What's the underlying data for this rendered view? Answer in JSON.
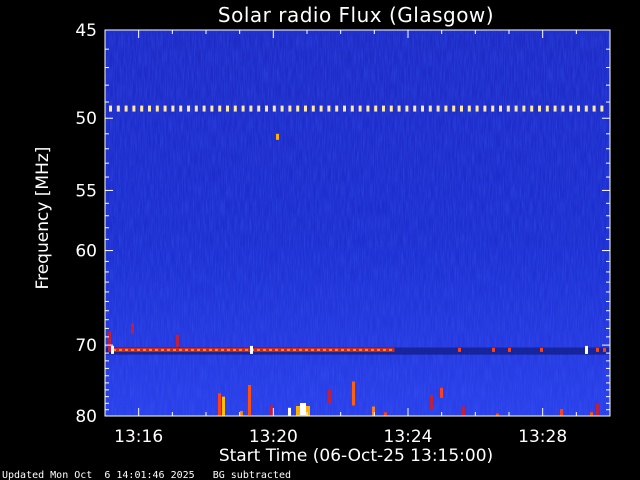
{
  "title": "Solar radio Flux (Glasgow)",
  "footer": "Updated Mon Oct  6 14:01:46 2025   BG subtracted",
  "chart_data": {
    "type": "heatmap",
    "title": "Solar radio Flux (Glasgow)",
    "xlabel": "Start Time (06-Oct-25 13:15:00)",
    "ylabel": "Frequency [MHz]",
    "x_tick_labels": [
      "13:16",
      "13:20",
      "13:24",
      "13:28"
    ],
    "x_ticks_minutes": [
      1,
      5,
      9,
      13
    ],
    "xlim_minutes": [
      0,
      15
    ],
    "y_tick_labels": [
      "45",
      "50",
      "55",
      "60",
      "70",
      "80"
    ],
    "y_ticks": [
      45,
      50,
      55,
      60,
      70,
      80
    ],
    "ylim": [
      45,
      80
    ],
    "y_scale": "reciprocal",
    "y_inverted": true,
    "colormap": [
      "#000080",
      "#1f2fd8",
      "#3548ff",
      "#c01040",
      "#ff6a00",
      "#ffd800",
      "#ffffff"
    ],
    "features": [
      {
        "kind": "dotted-line",
        "freq": 49.4,
        "color": "#ffe8a0"
      },
      {
        "kind": "dotted-line",
        "freq": 70.6,
        "color": "#ff5020"
      }
    ],
    "background_color": "#1c2fcc"
  }
}
